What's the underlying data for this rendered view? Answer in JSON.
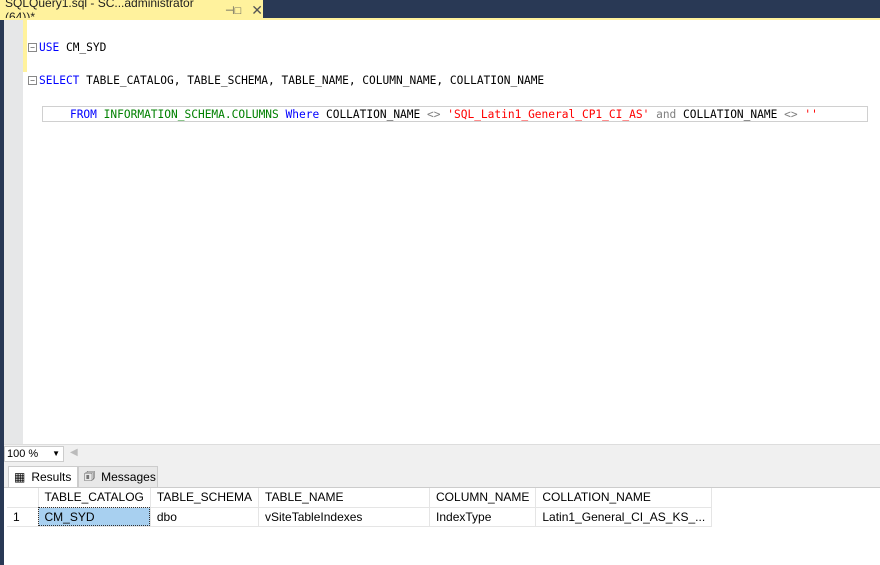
{
  "tab": {
    "title": "SQLQuery1.sql - SC...administrator (64))*",
    "pin_icon": "pin-icon",
    "close_icon": "close-icon"
  },
  "editor": {
    "lines": [
      {
        "kw": "USE",
        "rest": " CM_SYD"
      },
      {
        "kw": "SELECT",
        "rest": " TABLE_CATALOG, TABLE_SCHEMA, TABLE_NAME, COLUMN_NAME, COLLATION_NAME"
      },
      {
        "kw": "FROM",
        "sys": "INFORMATION_SCHEMA.COLUMNS",
        "where": "Where",
        "col1": "COLLATION_NAME",
        "op1": "<>",
        "str1": "'SQL_Latin1_General_CP1_CI_AS'",
        "and": "and",
        "col2": "COLLATION_NAME",
        "op2": "<>",
        "str2": "''"
      }
    ]
  },
  "zoom": {
    "value": "100 %"
  },
  "results_tabs": [
    {
      "label": "Results",
      "icon": "grid-icon"
    },
    {
      "label": "Messages",
      "icon": "messages-icon"
    }
  ],
  "grid": {
    "columns": [
      "TABLE_CATALOG",
      "TABLE_SCHEMA",
      "TABLE_NAME",
      "COLUMN_NAME",
      "COLLATION_NAME"
    ],
    "rows": [
      {
        "num": "1",
        "cells": [
          "CM_SYD",
          "dbo",
          "vSiteTableIndexes",
          "IndexType",
          "Latin1_General_CI_AS_KS_..."
        ]
      }
    ]
  },
  "colors": {
    "tab_active": "#fff29d",
    "chrome": "#293955",
    "keyword": "#0000ff",
    "system": "#008000",
    "string": "#ff0000"
  }
}
